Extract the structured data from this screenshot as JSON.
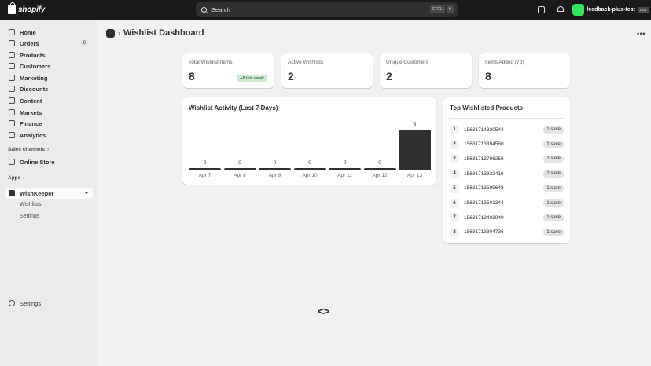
{
  "topbar": {
    "brand": "shopify",
    "search_placeholder": "Search",
    "kbd_ctrl": "CTRL",
    "kbd_k": "K",
    "store_name": "feedback-plus-test",
    "store_badge": "dev"
  },
  "sidebar": {
    "items": [
      {
        "label": "Home"
      },
      {
        "label": "Orders",
        "count": "6"
      },
      {
        "label": "Products"
      },
      {
        "label": "Customers"
      },
      {
        "label": "Marketing"
      },
      {
        "label": "Discounts"
      },
      {
        "label": "Content"
      },
      {
        "label": "Markets"
      },
      {
        "label": "Finance"
      },
      {
        "label": "Analytics"
      }
    ],
    "sales_channels_label": "Sales channels",
    "online_store_label": "Online Store",
    "apps_label": "Apps",
    "app_label": "WishKeeper",
    "app_sub": [
      "Wishlists",
      "Settings"
    ],
    "settings_label": "Settings"
  },
  "page": {
    "title": "Wishlist Dashboard"
  },
  "stats": [
    {
      "label": "Total Wishlist Items",
      "value": "8",
      "badge": "+8 this week"
    },
    {
      "label": "Active Wishlists",
      "value": "2"
    },
    {
      "label": "Unique Customers",
      "value": "2"
    },
    {
      "label": "Items Added (7d)",
      "value": "8"
    }
  ],
  "activity": {
    "title": "Wishlist Activity (Last 7 Days)"
  },
  "chart_data": {
    "type": "bar",
    "title": "Wishlist Activity (Last 7 Days)",
    "categories": [
      "Apr 7",
      "Apr 8",
      "Apr 9",
      "Apr 10",
      "Apr 11",
      "Apr 12",
      "Apr 13"
    ],
    "values": [
      0,
      0,
      0,
      0,
      0,
      0,
      8
    ],
    "ylim": [
      0,
      8
    ]
  },
  "top_products": {
    "title": "Top Wishlisted Products",
    "rows": [
      {
        "rank": "1",
        "id": "15631714320544",
        "saves": "1 save"
      },
      {
        "rank": "2",
        "id": "15631713894560",
        "saves": "1 save"
      },
      {
        "rank": "3",
        "id": "15631713796256",
        "saves": "1 save"
      },
      {
        "rank": "4",
        "id": "15631713832416",
        "saves": "1 save"
      },
      {
        "rank": "5",
        "id": "15631713599648",
        "saves": "1 save"
      },
      {
        "rank": "6",
        "id": "15631713501344",
        "saves": "1 save"
      },
      {
        "rank": "7",
        "id": "15631713403040",
        "saves": "1 save"
      },
      {
        "rank": "8",
        "id": "15631713304736",
        "saves": "1 save"
      }
    ]
  },
  "colors": {
    "topbar": "#1a1a1a",
    "accent_green": "#36e35e",
    "bar": "#303030",
    "badge_bg": "#cde9d0"
  }
}
